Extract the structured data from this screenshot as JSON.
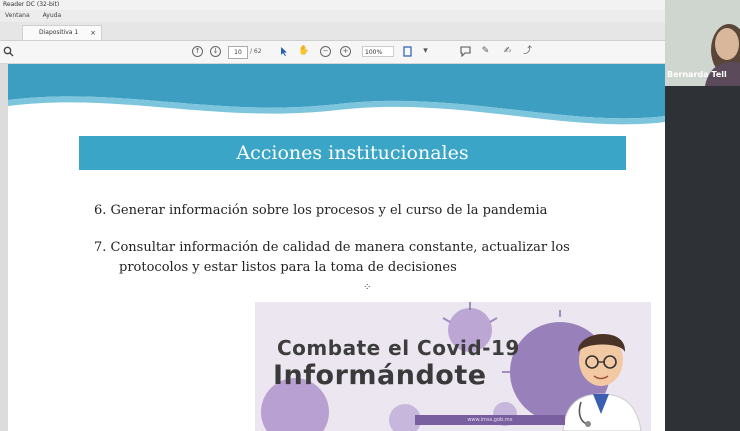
{
  "window": {
    "title": "Reader DC (32-bit)"
  },
  "menu": {
    "items": [
      "Ventana",
      "Ayuda"
    ]
  },
  "tab": {
    "label": "Diapositiva 1",
    "close": "×"
  },
  "toolbar": {
    "page_current": "10",
    "page_total": "/ 62",
    "zoom": "100%"
  },
  "slide": {
    "banner": "Acciones institucionales",
    "item6": "6. Generar información sobre los procesos y el curso de la pandemia",
    "item7_line1": "7. Consultar información de calidad de manera constante, actualizar los",
    "item7_line2": "protocolos y estar listos para la toma de decisiones",
    "covid_title1": "Combate el Covid-19",
    "covid_title2": "Informándote",
    "covid_footer": "www.imss.gob.mx"
  },
  "participant": {
    "name": "Bernarda Tell"
  },
  "colors": {
    "accent": "#3aa5c6",
    "covid_purple": "#8a6db0"
  }
}
